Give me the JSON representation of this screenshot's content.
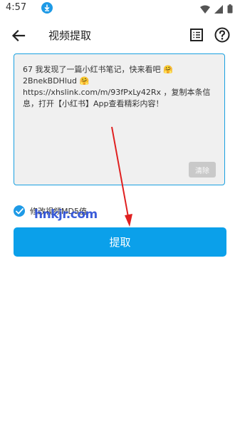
{
  "status_bar": {
    "time": "4:57",
    "download_icon": "download-arrow-icon",
    "wifi_icon": "wifi-icon",
    "signal_icon": "signal-icon",
    "battery_icon": "battery-icon"
  },
  "app_bar": {
    "title": "视频提取",
    "back_icon": "back-arrow-icon",
    "list_icon": "list-icon",
    "help_icon": "help-icon"
  },
  "share_text": {
    "line1": "67 我发现了一篇小红书笔记，快来看吧 🤗",
    "line2": "2BnekBDHlud 🤗",
    "line3": "https://xhslink.com/m/93fPxLy42Rx ，复制本条信息，打开【小红书】App查看精彩内容！"
  },
  "clear_button": {
    "label": "清除"
  },
  "modify_md5": {
    "label": "修改视频MD5值",
    "checked": true
  },
  "extract_button": {
    "label": "提取"
  },
  "watermark": {
    "text": "hnkjr.com"
  },
  "colors": {
    "accent": "#0ba0ea",
    "textarea_bg": "#f0f0f0",
    "annotation_arrow": "#e02020",
    "watermark": "#2b4fd6"
  }
}
